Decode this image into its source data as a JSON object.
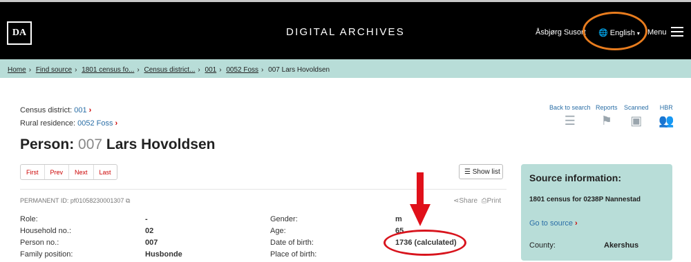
{
  "header": {
    "logo": "DA",
    "title": "DIGITAL ARCHIVES",
    "user": "Åsbjørg Susort",
    "language": "English",
    "menu": "Menu"
  },
  "breadcrumb": [
    "Home",
    "Find source",
    "1801 census fo...",
    "Census district...",
    "001",
    "0052 Foss",
    "007 Lars Hovoldsen"
  ],
  "context": {
    "district_label": "Census district:",
    "district_value": "001",
    "residence_label": "Rural residence:",
    "residence_value": "0052 Foss"
  },
  "tools": [
    "Back to search",
    "Reports",
    "Scanned",
    "HBR"
  ],
  "person": {
    "label": "Person:",
    "number": "007",
    "name": "Lars Hovoldsen"
  },
  "pager": [
    "First",
    "Prev",
    "Next",
    "Last"
  ],
  "show_list": "Show list",
  "permanent_id": "PERMANENT ID: pf01058230001307",
  "share": "Share",
  "print": "Print",
  "left_fields": [
    {
      "label": "Role:",
      "value": "-"
    },
    {
      "label": "Household no.:",
      "value": "02"
    },
    {
      "label": "Person no.:",
      "value": "007"
    },
    {
      "label": "Family position:",
      "value": "Husbonde"
    }
  ],
  "right_fields": [
    {
      "label": "Gender:",
      "value": "m"
    },
    {
      "label": "Age:",
      "value": "65"
    },
    {
      "label": "Date of birth:",
      "value": "1736 (calculated)"
    },
    {
      "label": "Place of birth:",
      "value": ""
    }
  ],
  "source_info": {
    "title": "Source information:",
    "source": "1801 census for 0238P Nannestad",
    "link": "Go to source",
    "county_label": "County:",
    "county_value": "Akershus"
  },
  "annotation_color": "#e87c1e",
  "highlight_color": "#d8141d"
}
